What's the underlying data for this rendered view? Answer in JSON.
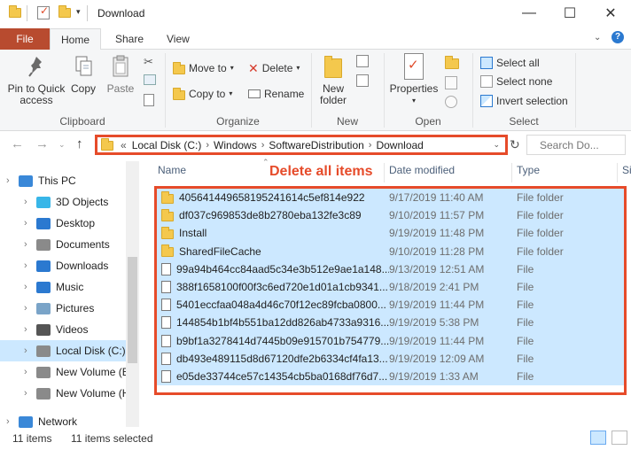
{
  "window": {
    "title": "Download",
    "quick_access_icons": [
      "folder-icon",
      "properties-check-icon",
      "new-folder-icon",
      "dropdown-arrow-icon"
    ],
    "controls": [
      "minimize-icon",
      "maximize-icon",
      "close-icon"
    ]
  },
  "ribbon_tabs": {
    "file": "File",
    "home": "Home",
    "share": "Share",
    "view": "View"
  },
  "ribbon": {
    "clipboard": {
      "group_label": "Clipboard",
      "pin_label_1": "Pin to Quick",
      "pin_label_2": "access",
      "copy_label": "Copy",
      "paste_label": "Paste"
    },
    "organize": {
      "group_label": "Organize",
      "move_to": "Move to",
      "copy_to": "Copy to",
      "delete": "Delete",
      "rename": "Rename"
    },
    "new": {
      "group_label": "New",
      "new_folder_1": "New",
      "new_folder_2": "folder"
    },
    "open": {
      "group_label": "Open",
      "properties": "Properties"
    },
    "select": {
      "group_label": "Select",
      "select_all": "Select all",
      "select_none": "Select none",
      "invert_selection": "Invert selection"
    }
  },
  "address": {
    "prefix": "«",
    "crumbs": [
      "Local Disk (C:)",
      "Windows",
      "SoftwareDistribution",
      "Download"
    ],
    "search_placeholder": "Search Do..."
  },
  "annotation": {
    "text": "Delete all items",
    "color": "#e64b2a"
  },
  "nav_pane": {
    "items": [
      {
        "label": "This PC",
        "icon": "computer-icon",
        "level": 0
      },
      {
        "label": "3D Objects",
        "icon": "3d-objects-icon",
        "level": 1
      },
      {
        "label": "Desktop",
        "icon": "desktop-icon",
        "level": 1
      },
      {
        "label": "Documents",
        "icon": "documents-icon",
        "level": 1
      },
      {
        "label": "Downloads",
        "icon": "downloads-icon",
        "level": 1
      },
      {
        "label": "Music",
        "icon": "music-icon",
        "level": 1
      },
      {
        "label": "Pictures",
        "icon": "pictures-icon",
        "level": 1
      },
      {
        "label": "Videos",
        "icon": "videos-icon",
        "level": 1
      },
      {
        "label": "Local Disk (C:)",
        "icon": "drive-icon",
        "level": 1,
        "selected": true
      },
      {
        "label": "New Volume (E:)",
        "icon": "drive-icon",
        "level": 1
      },
      {
        "label": "New Volume (H:)",
        "icon": "drive-icon",
        "level": 1
      },
      {
        "label": "Network",
        "icon": "network-icon",
        "level": 0
      }
    ]
  },
  "columns": {
    "name": "Name",
    "date_modified": "Date modified",
    "type": "Type",
    "size": "Si"
  },
  "files": [
    {
      "name": "405641449658195241614c5ef814e922",
      "date": "9/17/2019 11:40 AM",
      "type": "File folder",
      "kind": "folder"
    },
    {
      "name": "df037c969853de8b2780eba132fe3c89",
      "date": "9/10/2019 11:57 PM",
      "type": "File folder",
      "kind": "folder"
    },
    {
      "name": "Install",
      "date": "9/19/2019 11:48 PM",
      "type": "File folder",
      "kind": "folder"
    },
    {
      "name": "SharedFileCache",
      "date": "9/10/2019 11:28 PM",
      "type": "File folder",
      "kind": "folder"
    },
    {
      "name": "99a94b464cc84aad5c34e3b512e9ae1a148...",
      "date": "9/13/2019 12:51 AM",
      "type": "File",
      "kind": "file"
    },
    {
      "name": "388f1658100f00f3c6ed720e1d01a1cb9341...",
      "date": "9/18/2019 2:41 PM",
      "type": "File",
      "kind": "file"
    },
    {
      "name": "5401eccfaa048a4d46c70f12ec89fcba0800...",
      "date": "9/19/2019 11:44 PM",
      "type": "File",
      "kind": "file"
    },
    {
      "name": "144854b1bf4b551ba12dd826ab4733a9316...",
      "date": "9/19/2019 5:38 PM",
      "type": "File",
      "kind": "file"
    },
    {
      "name": "b9bf1a3278414d7445b09e915701b754779...",
      "date": "9/19/2019 11:44 PM",
      "type": "File",
      "kind": "file"
    },
    {
      "name": "db493e489115d8d67120dfe2b6334cf4fa13...",
      "date": "9/19/2019 12:09 AM",
      "type": "File",
      "kind": "file"
    },
    {
      "name": "e05de33744ce57c14354cb5ba0168df76d7...",
      "date": "9/19/2019 1:33 AM",
      "type": "File",
      "kind": "file"
    }
  ],
  "status_bar": {
    "item_count": "11 items",
    "selected_count": "11 items selected"
  },
  "colors": {
    "selection": "#cce8ff",
    "file_tab": "#b84b2f",
    "highlight": "#e64b2a"
  }
}
